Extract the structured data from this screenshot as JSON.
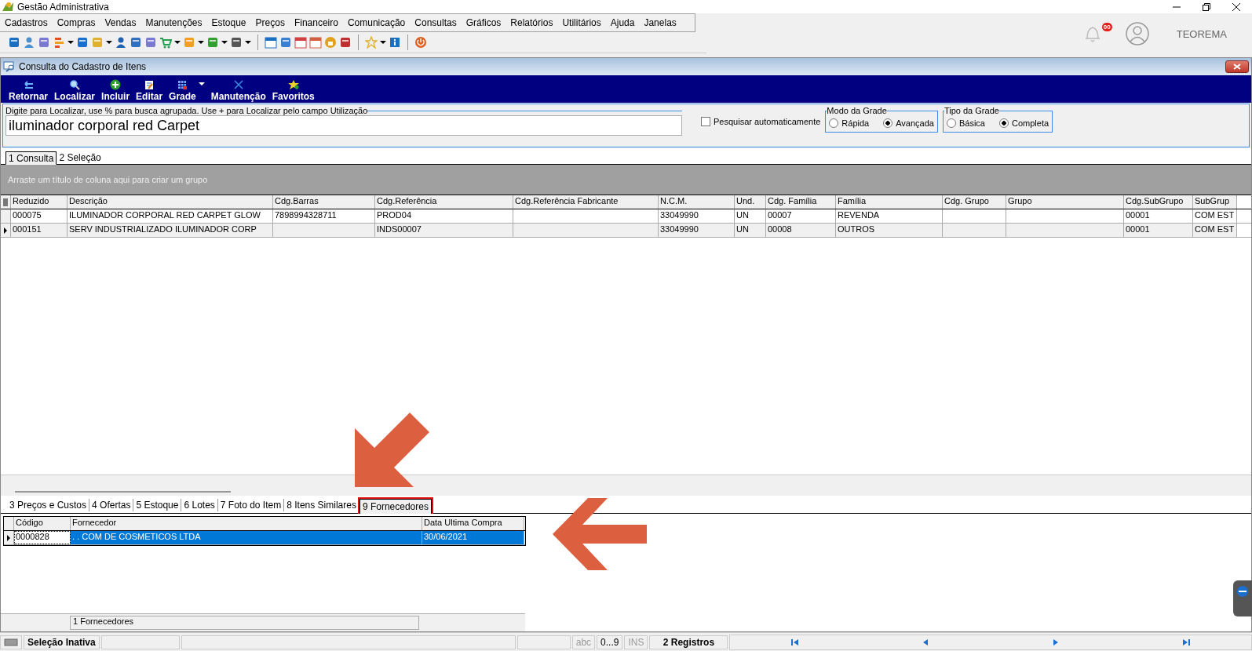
{
  "app": {
    "title": "Gestão Administrativa",
    "notifications": "00",
    "user": "TEOREMA"
  },
  "menu": [
    "Cadastros",
    "Compras",
    "Vendas",
    "Manutenções",
    "Estoque",
    "Preços",
    "Financeiro",
    "Comunicação",
    "Consultas",
    "Gráficos",
    "Relatórios",
    "Utilitários",
    "Ajuda",
    "Janelas"
  ],
  "window": {
    "title": "Consulta do Cadastro de Itens"
  },
  "actions": [
    {
      "label": "Retornar"
    },
    {
      "label": "Localizar"
    },
    {
      "label": "Incluir"
    },
    {
      "label": "Editar"
    },
    {
      "label": "Grade"
    },
    {
      "label": "Manutenção"
    },
    {
      "label": "Favoritos"
    }
  ],
  "search": {
    "legend": "Digite para Localizar, use % para busca agrupada. Use + para Localizar pelo campo Utilização",
    "value": "iluminador corporal red Carpet"
  },
  "auto_search": {
    "label": "Pesquisar automaticamente",
    "checked": false
  },
  "grid_mode": {
    "legend": "Modo da Grade",
    "options": [
      {
        "label": "Rápida",
        "selected": false
      },
      {
        "label": "Avançada",
        "selected": true
      }
    ]
  },
  "grid_type": {
    "legend": "Tipo da Grade",
    "options": [
      {
        "label": "Básica",
        "selected": false
      },
      {
        "label": "Completa",
        "selected": true
      }
    ]
  },
  "tabs": [
    {
      "label": "1 Consulta",
      "selected": true
    },
    {
      "label": "2 Seleção",
      "selected": false
    }
  ],
  "group_hint": "Arraste um título de coluna aqui para criar um grupo",
  "table": {
    "columns": [
      "Reduzido",
      "Descrição",
      "Cdg.Barras",
      "Cdg.Referência",
      "Cdg.Referência Fabricante",
      "N.C.M.",
      "Und.",
      "Cdg. Família",
      "Família",
      "Cdg. Grupo",
      "Grupo",
      "Cdg.SubGrupo",
      "SubGrup"
    ],
    "rows": [
      {
        "current": false,
        "cells": [
          "000075",
          "ILUMINADOR CORPORAL RED CARPET GLOW",
          "7898994328711",
          "PROD04",
          "",
          "33049990",
          "UN",
          "00007",
          "REVENDA",
          "",
          "",
          "00001",
          "COM EST"
        ]
      },
      {
        "current": true,
        "cells": [
          "000151",
          "SERV INDUSTRIALIZADO ILUMINADOR CORP",
          "",
          "INDS00007",
          "",
          "33049990",
          "UN",
          "00008",
          "OUTROS",
          "",
          "",
          "00001",
          "COM EST"
        ]
      }
    ]
  },
  "detail_tabs": [
    {
      "label": "3 Preços e Custos",
      "selected": false,
      "highlighted": false
    },
    {
      "label": "4 Ofertas",
      "selected": false,
      "highlighted": false
    },
    {
      "label": "5 Estoque",
      "selected": false,
      "highlighted": false
    },
    {
      "label": "6 Lotes",
      "selected": false,
      "highlighted": false
    },
    {
      "label": "7 Foto do Item",
      "selected": false,
      "highlighted": false
    },
    {
      "label": "8 Itens Similares",
      "selected": false,
      "highlighted": false
    },
    {
      "label": "9 Fornecedores",
      "selected": true,
      "highlighted": true
    }
  ],
  "suppliers": {
    "columns": [
      "Código",
      "Fornecedor",
      "Data Ultima Compra"
    ],
    "rows": [
      {
        "current": true,
        "selected": true,
        "cells": [
          "0000828",
          ". . COM DE COSMETICOS LTDA",
          "30/06/2021"
        ]
      }
    ],
    "footer": "1 Fornecedores"
  },
  "annotations": [
    {
      "kind": "arrow-down-left"
    },
    {
      "kind": "arrow-left"
    }
  ],
  "status_bar": {
    "selection": "Seleção Inativa",
    "indicators": [
      {
        "label": "abc",
        "disabled": true
      },
      {
        "label": "0...9",
        "disabled": false
      },
      {
        "label": "INS",
        "disabled": true
      }
    ],
    "records": "2 Registros"
  }
}
